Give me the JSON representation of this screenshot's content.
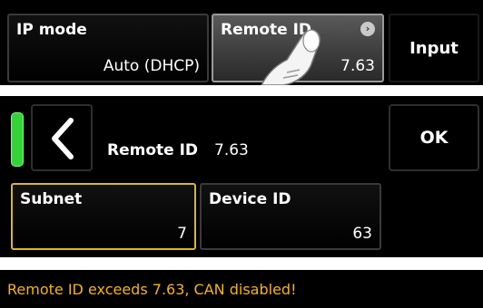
{
  "screen1": {
    "ip_mode": {
      "label": "IP mode",
      "value": "Auto (DHCP)"
    },
    "remote_id": {
      "label": "Remote ID",
      "value": "7.63"
    },
    "input_button": {
      "label": "Input"
    }
  },
  "screen2": {
    "header": {
      "label": "Remote ID",
      "value": "7.63"
    },
    "ok_button": {
      "label": "OK"
    },
    "subnet": {
      "label": "Subnet",
      "value": "7"
    },
    "device_id": {
      "label": "Device ID",
      "value": "63"
    }
  },
  "screen3": {
    "warning": "Remote ID exceeds 7.63, CAN disabled!"
  },
  "colors": {
    "status_green": "#35d23a",
    "selected_border": "#d9b630",
    "warning_text": "#f5b41a"
  },
  "icons": [
    "chevron-right-icon",
    "chevron-left-icon",
    "hand-pointer-icon"
  ]
}
